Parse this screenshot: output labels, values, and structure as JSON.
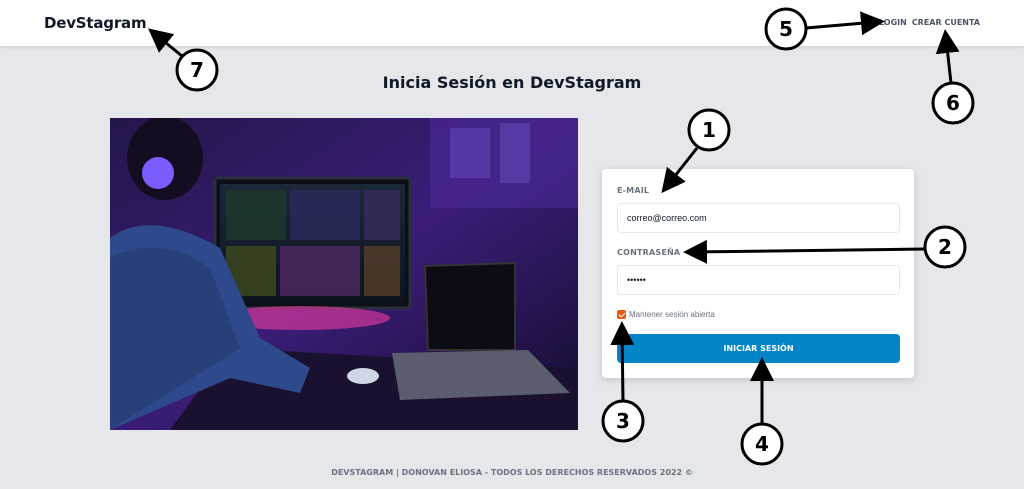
{
  "header": {
    "logo": "DevStagram",
    "nav": {
      "login": "LOGIN",
      "signup": "CREAR CUENTA"
    }
  },
  "page_title": "Inicia Sesión en DevStagram",
  "form": {
    "email_label": "E-MAIL",
    "email_value": "correo@correo.com",
    "password_label": "CONTRASEÑA",
    "password_value": "••••••",
    "remember_label": "Mantener sesión abierta",
    "remember_checked": true,
    "submit_label": "INICIAR SESIÓN"
  },
  "footer": "DEVSTAGRAM | DONOVAN ELIOSA - TODOS LOS DERECHOS RESERVADOS 2022 ©",
  "annotations": [
    "1",
    "2",
    "3",
    "4",
    "5",
    "6",
    "7"
  ],
  "colors": {
    "primary_button": "#0284c7",
    "checkbox": "#ea580c",
    "background": "#e5e7eb"
  }
}
